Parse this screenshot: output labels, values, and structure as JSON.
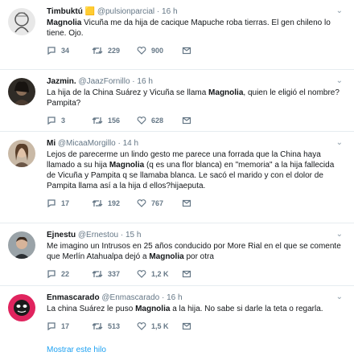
{
  "tweets": [
    {
      "name": "Timbuktú",
      "handle": "@pulsionparcial",
      "time": "16 h",
      "text_pre": "",
      "bold": "Magnolia",
      "text_post": " Vicuña me da hija de cacique Mapuche roba tierras. El gen chileno lo tiene. Ojo.",
      "replies": "34",
      "retweets": "229",
      "likes": "900"
    },
    {
      "name": "Jazmin.",
      "handle": "@JaazFornillo",
      "time": "16 h",
      "text_pre": "La hija de la China Suárez y Vicuña se llama ",
      "bold": "Magnolia",
      "text_post": ", quien le eligió el nombre? Pampita?",
      "replies": "3",
      "retweets": "156",
      "likes": "628"
    },
    {
      "name": "Mi",
      "handle": "@MicaaMorgillo",
      "time": "14 h",
      "text_pre": "Lejos de parecerme un lindo gesto me parece una forrada que la China haya llamado a su hija ",
      "bold": "Magnolia",
      "text_post": " (q es una flor blanca) en \"memoria\" a la hija fallecida de Vicuña y Pampita q se llamaba blanca. Le sacó el marido y con el dolor de Pampita llama así a la hija d ellos?hijaeputa.",
      "replies": "17",
      "retweets": "192",
      "likes": "767"
    },
    {
      "name": "Ejnestu",
      "handle": "@Ernestou",
      "time": "15 h",
      "text_pre": "Me imagino un Intrusos en 25 años conducido por More Rial en el que se comente que Merlín Atahualpa dejó a ",
      "bold": "Magnolia",
      "text_post": " por otra",
      "replies": "22",
      "retweets": "337",
      "likes": "1,2 K"
    },
    {
      "name": "Enmascarado",
      "handle": "@Enmascarado",
      "time": "16 h",
      "text_pre": "La china Suárez le puso ",
      "bold": "Magnolia",
      "text_post": " a la hija. No sabe si darle la teta o regarla.",
      "replies": "17",
      "retweets": "513",
      "likes": "1,5 K"
    }
  ],
  "show_thread": "Mostrar este hilo",
  "colors": {
    "accent": "#1da1f2",
    "muted": "#657786",
    "border": "#e6ecf0"
  }
}
